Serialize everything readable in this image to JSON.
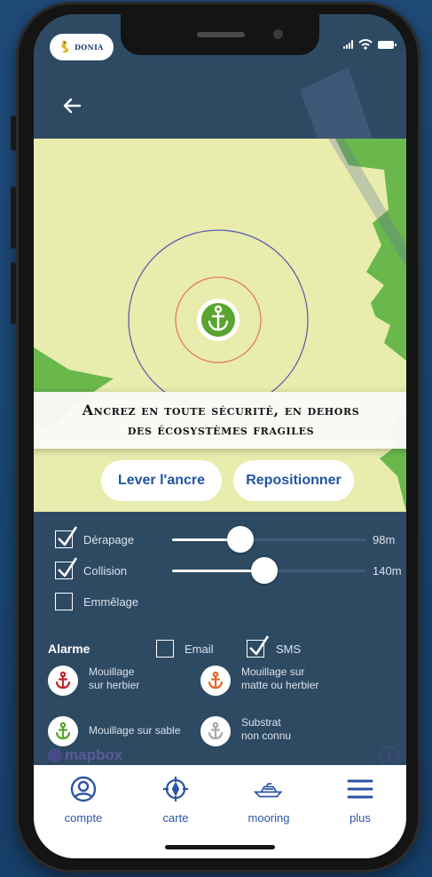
{
  "logo": {
    "text": "DONIA"
  },
  "banner": {
    "line1": "Ancrez en toute sécurité, en dehors",
    "line2": "des écosystèmes fragiles"
  },
  "map_actions": {
    "lift_anchor": "Lever l'ancre",
    "reposition": "Repositionner"
  },
  "settings": {
    "rows": [
      {
        "label": "Dérapage",
        "checked": true,
        "value": "98m",
        "slider_fraction": 0.35
      },
      {
        "label": "Collision",
        "checked": true,
        "value": "140m",
        "slider_fraction": 0.48
      },
      {
        "label": "Emmêlage",
        "checked": false
      }
    ]
  },
  "alarm": {
    "title": "Alarme",
    "email": {
      "label": "Email",
      "checked": false
    },
    "sms": {
      "label": "SMS",
      "checked": true
    }
  },
  "legend": [
    {
      "line1": "Mouillage",
      "line2": "sur herbier",
      "color": "#c0262d",
      "icon": "anchor-icon"
    },
    {
      "line1": "Mouillage sur",
      "line2": "matte ou herbier",
      "color": "#e2692a",
      "icon": "anchor-icon"
    },
    {
      "line1": "Mouillage sur sable",
      "line2": "",
      "color": "#5aa52f",
      "icon": "anchor-icon"
    },
    {
      "line1": "Substrat",
      "line2": "non connu",
      "color": "#a9a9a9",
      "icon": "anchor-icon"
    }
  ],
  "mapbox": {
    "text": "mapbox"
  },
  "tabs": [
    {
      "label": "compte",
      "icon": "user-icon"
    },
    {
      "label": "carte",
      "icon": "compass-icon"
    },
    {
      "label": "mooring",
      "icon": "boat-icon"
    },
    {
      "label": "plus",
      "icon": "menu-icon"
    }
  ],
  "colors": {
    "panel": "#2e4a63",
    "land": "#e8ecac",
    "sea_green": "#6ab84c",
    "accent_blue": "#2d55a6",
    "outer_circle": "#5a5fb2",
    "inner_circle": "#e07d5c"
  }
}
